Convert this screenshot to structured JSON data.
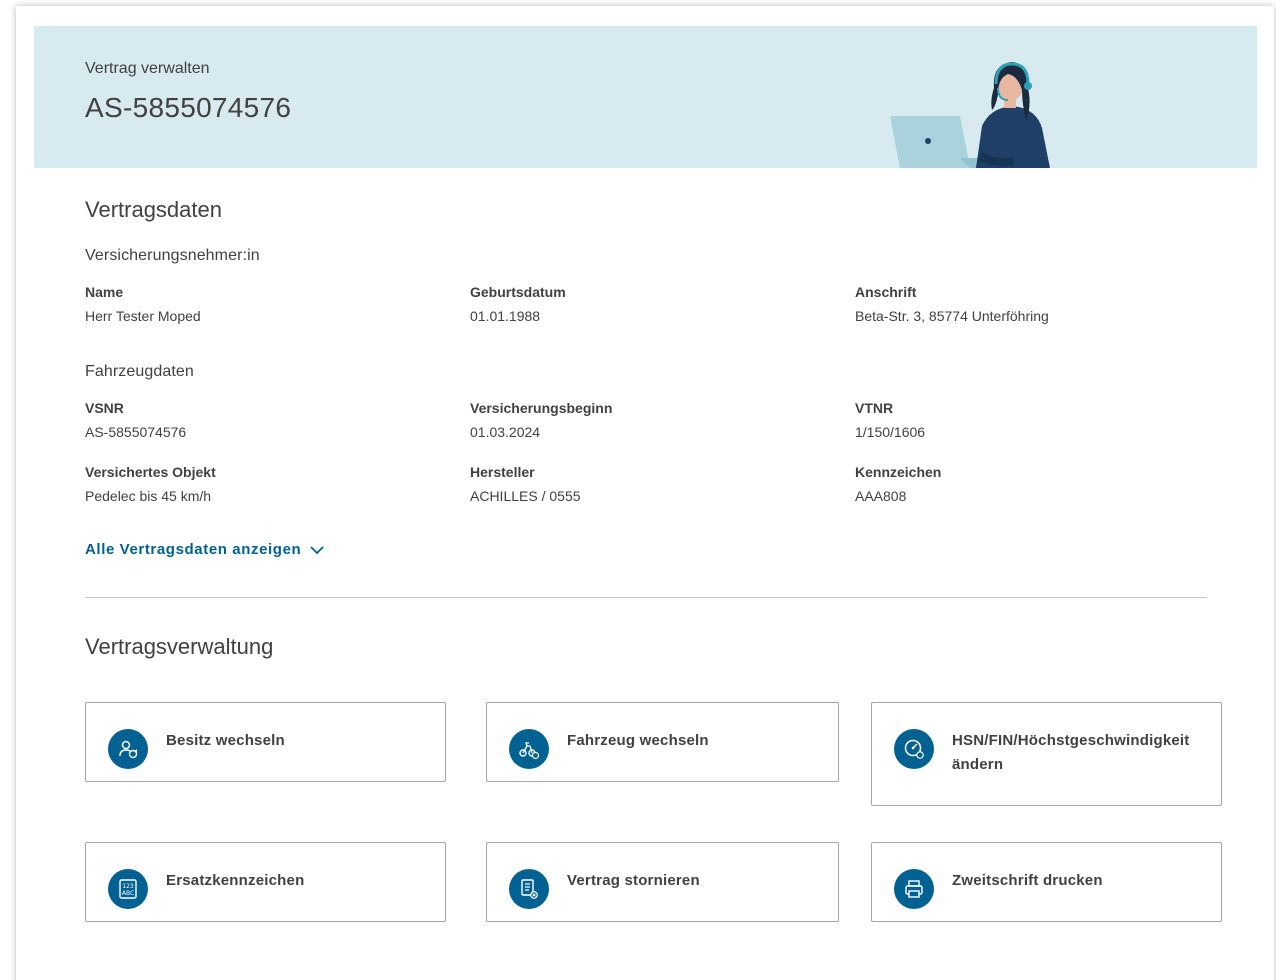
{
  "header": {
    "subtitle": "Vertrag verwalten",
    "contract_number": "AS-5855074576"
  },
  "contract_data": {
    "title": "Vertragsdaten",
    "policyholder": {
      "title": "Versicherungsnehmer:in",
      "fields": [
        {
          "label": "Name",
          "value": "Herr Tester Moped"
        },
        {
          "label": "Geburtsdatum",
          "value": "01.01.1988"
        },
        {
          "label": "Anschrift",
          "value": "Beta-Str. 3, 85774 Unterföhring"
        }
      ]
    },
    "vehicle": {
      "title": "Fahrzeugdaten",
      "fields": [
        {
          "label": "VSNR",
          "value": "AS-5855074576"
        },
        {
          "label": "Versicherungsbeginn",
          "value": "01.03.2024"
        },
        {
          "label": "VTNR",
          "value": "1/150/1606"
        },
        {
          "label": "Versichertes Objekt",
          "value": "Pedelec bis 45 km/h"
        },
        {
          "label": "Hersteller",
          "value": "ACHILLES / 0555"
        },
        {
          "label": "Kennzeichen",
          "value": "AAA808"
        }
      ]
    },
    "show_all_link": "Alle Vertragsdaten anzeigen"
  },
  "management": {
    "title": "Vertragsverwaltung",
    "actions": [
      {
        "label": "Besitz wechseln",
        "icon": "owner-change-icon"
      },
      {
        "label": "Fahrzeug wechseln",
        "icon": "vehicle-change-icon"
      },
      {
        "label_line1": "HSN/FIN/Höchstgeschwindigkeit",
        "label_line2": "ändern",
        "icon": "speedometer-icon"
      },
      {
        "label": "Ersatzkennzeichen",
        "icon": "license-plate-icon"
      },
      {
        "label": "Vertrag stornieren",
        "icon": "cancel-contract-icon"
      },
      {
        "label": "Zweitschrift drucken",
        "icon": "printer-icon"
      }
    ]
  },
  "colors": {
    "hero_background": "#d6eaf0",
    "accent": "#006192",
    "text": "#414141"
  }
}
